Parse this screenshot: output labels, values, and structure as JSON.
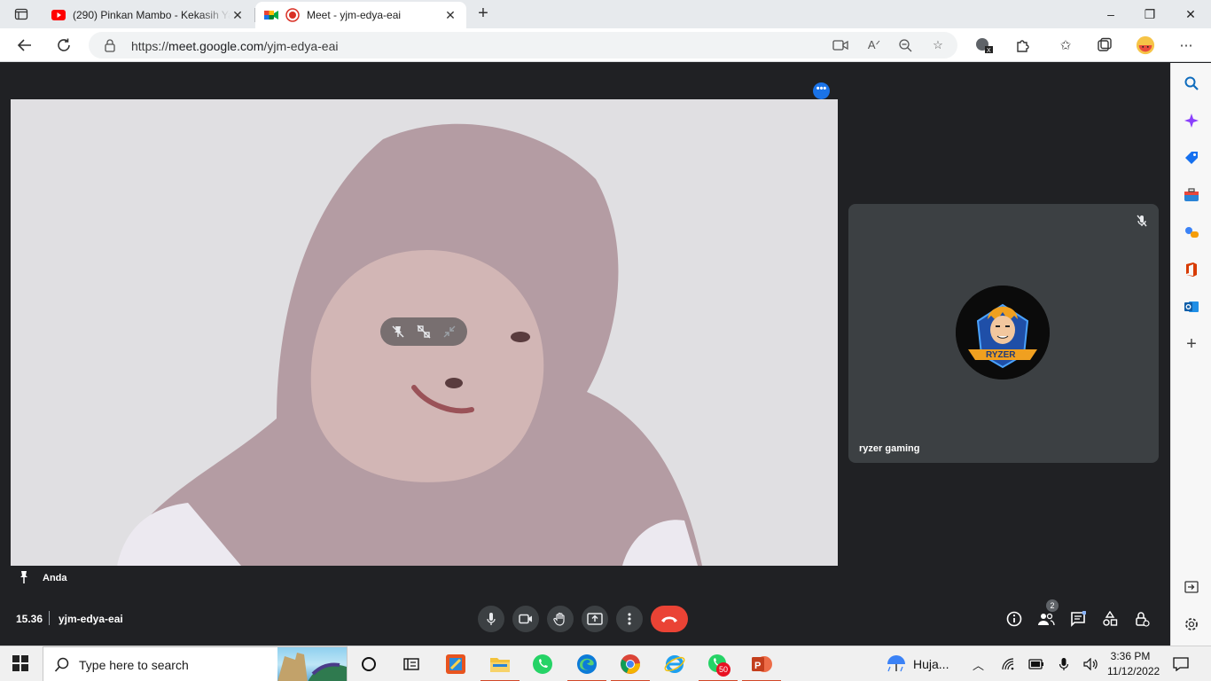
{
  "browser": {
    "tabs": [
      {
        "title": "(290) Pinkan Mambo - Kekasih Yang Tak Dianggap",
        "close": "✕"
      },
      {
        "title": "Meet - yjm-edya-eai",
        "close": "✕"
      }
    ],
    "new_tab": "+",
    "window": {
      "minimize": "–",
      "maximize": "❐",
      "close": "✕"
    },
    "url_scheme": "https://",
    "url_host": "meet.google.com",
    "url_path": "/yjm-edya-eai"
  },
  "meet": {
    "self_name": "Anda",
    "participant_name": "ryzer gaming",
    "avatar_text": "RYZER",
    "meeting_time": "15.36",
    "meeting_code": "yjm-edya-eai",
    "participant_count": "2",
    "more_options": "•••"
  },
  "taskbar": {
    "search_placeholder": "Type here to search",
    "weather": "Huja...",
    "whatsapp_badge": "50",
    "time": "3:36 PM",
    "date": "11/12/2022"
  },
  "colors": {
    "meet_bg": "#202124",
    "tile_bg": "#3c4043",
    "end_call": "#ea4335",
    "accent": "#1a73e8"
  }
}
